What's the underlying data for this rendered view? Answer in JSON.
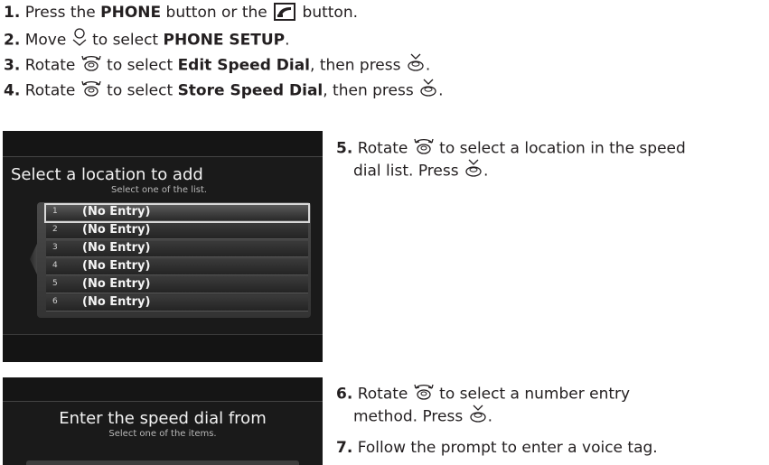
{
  "steps": [
    {
      "num": "1.",
      "pre": "Press the ",
      "kw": "PHONE",
      "mid": " button or the ",
      "post": " button."
    },
    {
      "num": "2.",
      "pre": "Move ",
      "mid": " to select ",
      "kw": "PHONE SETUP",
      "post": "."
    },
    {
      "num": "3.",
      "pre": "Rotate ",
      "mid": " to select ",
      "kw": "Edit Speed Dial",
      "post": ", then press ",
      "end": "."
    },
    {
      "num": "4.",
      "pre": "Rotate ",
      "mid": " to select ",
      "kw": "Store Speed Dial",
      "post": ", then press ",
      "end": "."
    }
  ],
  "step5": {
    "num": "5.",
    "pre": "Rotate ",
    "line1": " to select a location in the speed",
    "line2": "dial list. Press ",
    "end": "."
  },
  "step6": {
    "num": "6.",
    "pre": "Rotate ",
    "line1": " to select a number entry",
    "line2": "method. Press ",
    "end": "."
  },
  "step7": {
    "num": "7.",
    "text": "Follow the prompt to enter a voice tag."
  },
  "screen1": {
    "title": "Select a location to add",
    "subtitle": "Select one of the list.",
    "rows": [
      {
        "n": "1",
        "t": "(No Entry)"
      },
      {
        "n": "2",
        "t": "(No Entry)"
      },
      {
        "n": "3",
        "t": "(No Entry)"
      },
      {
        "n": "4",
        "t": "(No Entry)"
      },
      {
        "n": "5",
        "t": "(No Entry)"
      },
      {
        "n": "6",
        "t": "(No Entry)"
      }
    ]
  },
  "screen2": {
    "title": "Enter the speed dial from",
    "subtitle": "Select one of the items."
  },
  "icons": {
    "phone": "phone-button-icon",
    "move": "joystick-move-icon",
    "rotate": "interface-dial-rotate-icon",
    "press": "interface-dial-press-icon"
  }
}
